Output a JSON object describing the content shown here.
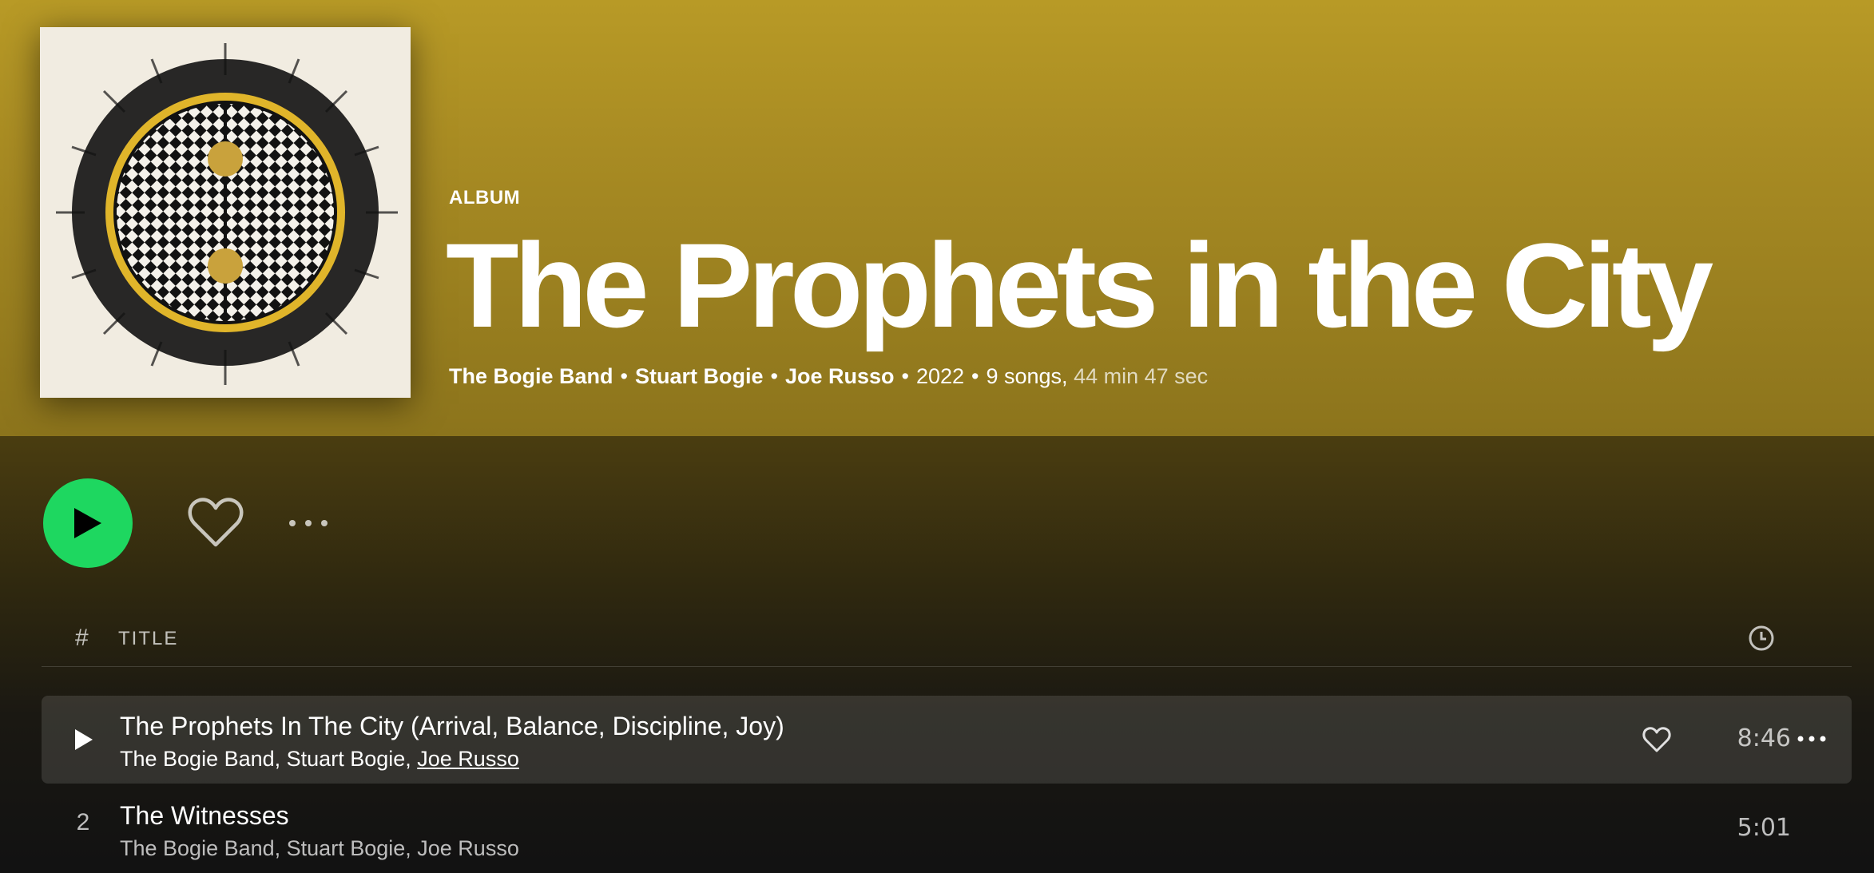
{
  "album": {
    "type_label": "ALBUM",
    "title": "The Prophets in the City",
    "artists": [
      "The Bogie Band",
      "Stuart Bogie",
      "Joe Russo"
    ],
    "separator": "•",
    "year": "2022",
    "song_count": "9 songs,",
    "duration": "44 min 47 sec"
  },
  "actions": {
    "play_icon": "play-icon",
    "like_icon": "heart-icon",
    "more_icon": "more-icon"
  },
  "table_header": {
    "number": "#",
    "title": "TITLE",
    "duration_icon": "clock-icon"
  },
  "tracks": [
    {
      "number": "1",
      "title": "The Prophets In The City (Arrival, Balance, Discipline, Joy)",
      "artist_1": "The Bogie Band",
      "artist_2": "Stuart Bogie",
      "artist_3": "Joe Russo",
      "duration": "8:46",
      "state": "hover"
    },
    {
      "number": "2",
      "title": "The Witnesses",
      "artist_1": "The Bogie Band",
      "artist_2": "Stuart Bogie",
      "artist_3": "Joe Russo",
      "duration": "5:01",
      "state": "normal"
    }
  ],
  "colors": {
    "accent": "#1ed760",
    "header_top": "#b89a26",
    "header_bottom": "#8c741c",
    "background": "#121212"
  }
}
